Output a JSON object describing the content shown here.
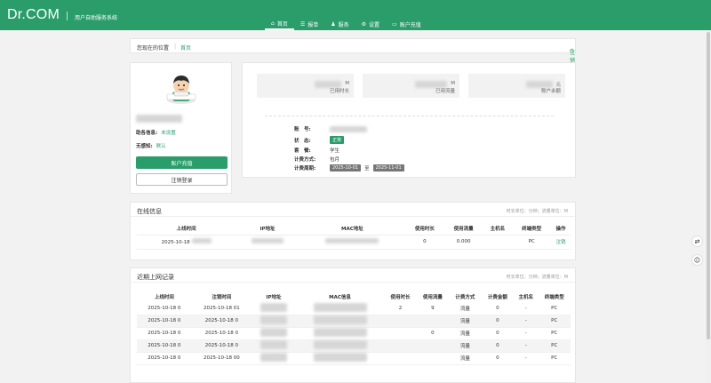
{
  "brand": {
    "logo": "Dr.COM",
    "system_name": "用户自助服务系统",
    "accent": "#2a9d6b"
  },
  "nav": [
    {
      "label": "首页",
      "icon": "home-icon"
    },
    {
      "label": "报单",
      "icon": "list-icon"
    },
    {
      "label": "服务",
      "icon": "user-icon"
    },
    {
      "label": "设置",
      "icon": "gear-icon"
    },
    {
      "label": "账户充值",
      "icon": "card-icon"
    }
  ],
  "breadcrumb": {
    "label": "您现在的位置",
    "sep": "|",
    "home": "首页",
    "logout": "注销"
  },
  "profile": {
    "bind_label": "助各信息:",
    "bind_value": "未设置",
    "notice_label": "无感知:",
    "notice_value": "默认",
    "recharge_button": "账户充值",
    "logout_button": "注销登录"
  },
  "stats": [
    {
      "unit": "M",
      "label": "已用时长"
    },
    {
      "unit": "M",
      "label": "已用流量"
    },
    {
      "unit": "元",
      "label": "账户余额"
    }
  ],
  "account_info": {
    "account_label": "账　号:",
    "status_label": "状　态:",
    "status_value": "正常",
    "group_label": "套　餐:",
    "group_value": "学生",
    "billing_label": "计费方式:",
    "billing_value": "包月",
    "period_label": "计费周期:",
    "period_start": "2025-10-01",
    "period_to": "至",
    "period_end": "2025-11-01"
  },
  "online": {
    "title": "在线信息",
    "meta": "时长单位：分钟；流量单位：M",
    "headers": [
      "上线时间",
      "IP地址",
      "MAC地址",
      "使用时长",
      "使用流量",
      "主机名",
      "终端类型",
      "操作"
    ],
    "row": {
      "time": "2025-10-18",
      "ip": "",
      "mac": "",
      "duration": "0",
      "flow": "0.000",
      "host": "",
      "terminal": "PC",
      "action": "注销"
    }
  },
  "recent": {
    "title": "近期上网记录",
    "meta": "时长单位：分钟；流量单位：M",
    "headers": [
      "上线时间",
      "注销时间",
      "IP地址",
      "MAC信息",
      "使用时长",
      "使用流量",
      "计费方式",
      "计费金额",
      "主机名",
      "终端类型"
    ],
    "rows": [
      {
        "on": "2025-10-18 0",
        "off": "2025-10-18 01",
        "dur": "2",
        "flow": "9",
        "mode": "流量",
        "fee": "0",
        "host": "-",
        "term": "PC"
      },
      {
        "on": "2025-10-18 0",
        "off": "2025-10-18 0",
        "dur": "",
        "flow": "",
        "mode": "流量",
        "fee": "0",
        "host": "-",
        "term": "PC"
      },
      {
        "on": "2025-10-18 0",
        "off": "2025-10-18 0",
        "dur": "",
        "flow": "0",
        "mode": "流量",
        "fee": "0",
        "host": "-",
        "term": "PC"
      },
      {
        "on": "2025-10-18 0",
        "off": "2025-10-18 0",
        "dur": "",
        "flow": "",
        "mode": "流量",
        "fee": "0",
        "host": "-",
        "term": "PC"
      },
      {
        "on": "2025-10-18 0",
        "off": "2025-10-18 00",
        "dur": "",
        "flow": "",
        "mode": "流量",
        "fee": "0",
        "host": "-",
        "term": "PC"
      }
    ]
  }
}
